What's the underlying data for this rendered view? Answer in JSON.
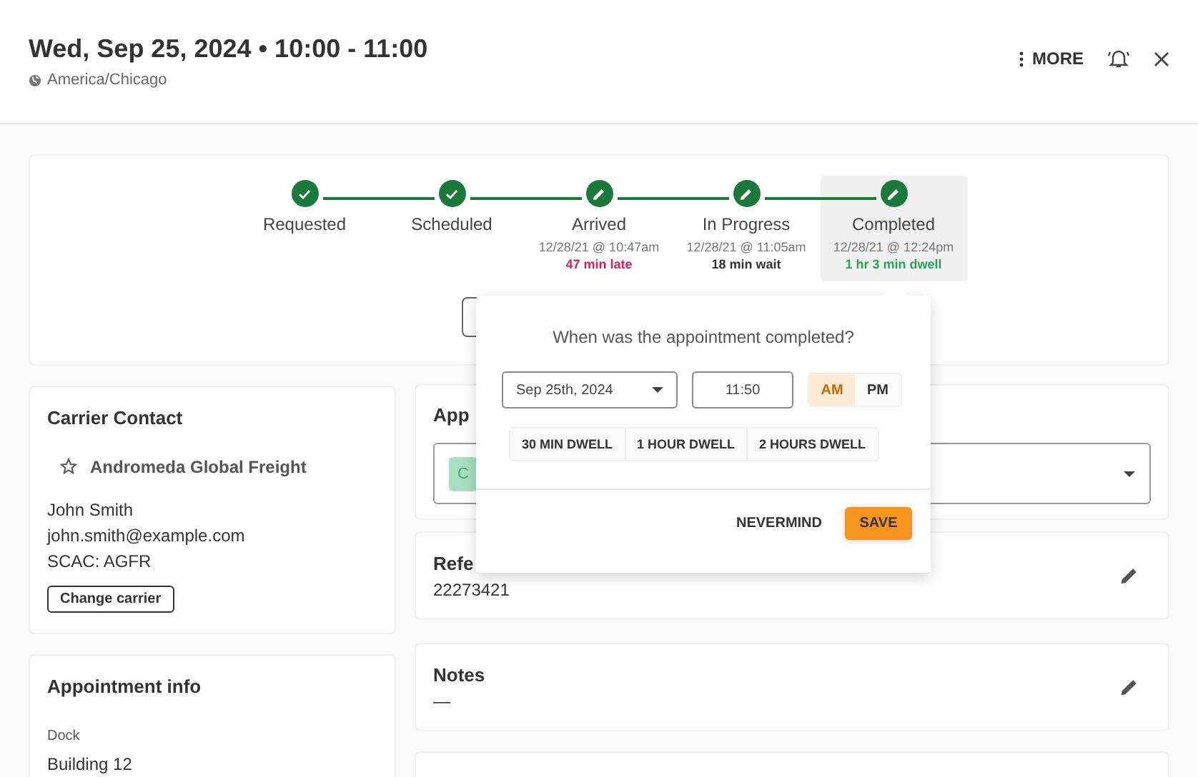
{
  "header": {
    "title": "Wed, Sep 25, 2024 • 10:00 - 11:00",
    "timezone": "America/Chicago",
    "more_label": "MORE"
  },
  "steps": [
    {
      "label": "Requested",
      "kind": "confirmed",
      "selected": false
    },
    {
      "label": "Scheduled",
      "kind": "confirmed",
      "selected": false
    },
    {
      "label": "Arrived",
      "kind": "editable",
      "time": "12/28/21 @ 10:47am",
      "note": "47 min late",
      "color": "#e0185f",
      "selected": false
    },
    {
      "label": "In Progress",
      "kind": "editable",
      "time": "12/28/21 @ 11:05am",
      "note": "18 min wait",
      "color": "#333333",
      "selected": false
    },
    {
      "label": "Completed",
      "kind": "editable",
      "time": "12/28/21 @ 12:24pm",
      "note": "1 hr 3 min dwell",
      "color": "#2aa356",
      "selected": true
    }
  ],
  "carrier": {
    "title": "Carrier Contact",
    "company": "Andromeda Global Freight",
    "lines": [
      "John Smith",
      "john.smith@example.com",
      "SCAC: AGFR"
    ],
    "button": "Change carrier"
  },
  "appointment_info": {
    "title": "Appointment info",
    "field_label": "Dock",
    "field_value": "Building 12"
  },
  "status_card": {
    "title": "App",
    "chip": "C"
  },
  "reference_card": {
    "title": "Refe",
    "value": "22273421"
  },
  "notes_card": {
    "title": "Notes",
    "value": "—"
  },
  "popover": {
    "question": "When was the appointment completed?",
    "date": "Sep 25th, 2024",
    "time": "11:50",
    "meridiem": [
      {
        "label": "AM",
        "selected": true
      },
      {
        "label": "PM",
        "selected": false
      }
    ],
    "dwell_buttons": [
      "30 MIN DWELL",
      "1 HOUR DWELL",
      "2 HOURS DWELL"
    ],
    "cancel": "NEVERMIND",
    "save": "SAVE"
  }
}
